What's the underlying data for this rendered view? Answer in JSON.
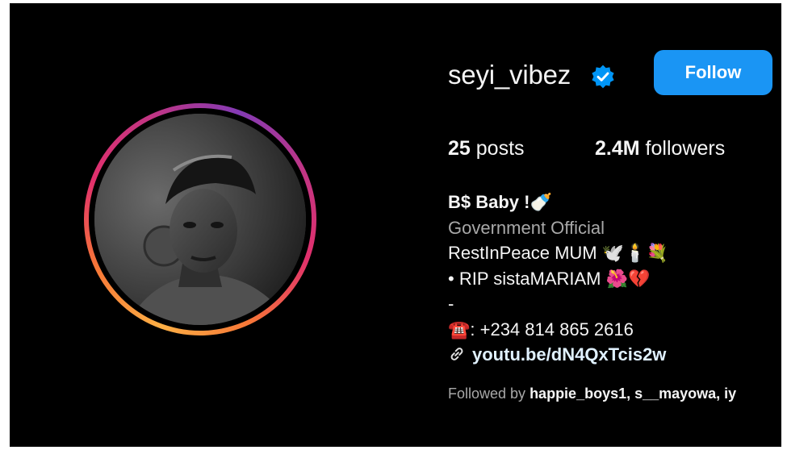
{
  "profile": {
    "username": "seyi_vibez",
    "follow_label": "Follow",
    "stats": {
      "posts_count": "25",
      "posts_label": "posts",
      "followers_count": "2.4M",
      "followers_label": "followers"
    },
    "bio": {
      "name": "B$ Baby !🍼",
      "category": "Government Official",
      "line1": "RestInPeace MUM 🕊️🕯️💐",
      "line2": "• RIP sistaMARIAM 🌺💔",
      "line3": "-",
      "phone": "☎️: +234 814 865 2616",
      "link": "youtu.be/dN4QxTcis2w"
    },
    "followed_by": {
      "prefix": "Followed by",
      "names": "happie_boys1, s__mayowa, iy"
    }
  },
  "icons": {
    "verified": "verified-badge-icon",
    "link": "link-icon"
  },
  "colors": {
    "background": "#000000",
    "follow_button": "#1a95f4",
    "verified": "#0095f6",
    "secondary_text": "#a8a8a8"
  }
}
